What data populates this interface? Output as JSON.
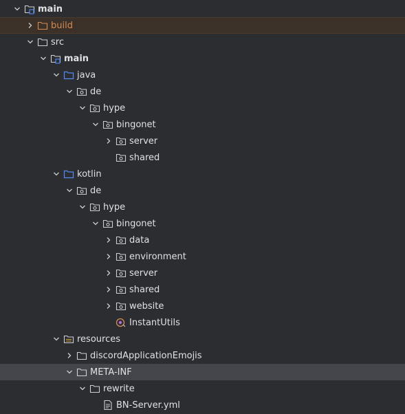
{
  "tree": [
    {
      "id": "r0",
      "label": "main",
      "depth": 0,
      "expanded": true,
      "icon": "module-folder-icon",
      "bold": true
    },
    {
      "id": "r1",
      "label": "build",
      "depth": 1,
      "expanded": false,
      "icon": "excluded-folder-icon",
      "color": "#d68b53",
      "state": "highlighted"
    },
    {
      "id": "r2",
      "label": "src",
      "depth": 1,
      "expanded": true,
      "icon": "folder-icon"
    },
    {
      "id": "r3",
      "label": "main",
      "depth": 2,
      "expanded": true,
      "icon": "module-folder-icon",
      "bold": true
    },
    {
      "id": "r4",
      "label": "java",
      "depth": 3,
      "expanded": true,
      "icon": "source-root-folder-icon"
    },
    {
      "id": "r5",
      "label": "de",
      "depth": 4,
      "expanded": true,
      "icon": "package-icon"
    },
    {
      "id": "r6",
      "label": "hype",
      "depth": 5,
      "expanded": true,
      "icon": "package-icon"
    },
    {
      "id": "r7",
      "label": "bingonet",
      "depth": 6,
      "expanded": true,
      "icon": "package-icon"
    },
    {
      "id": "r8",
      "label": "server",
      "depth": 7,
      "expanded": false,
      "icon": "package-icon"
    },
    {
      "id": "r9",
      "label": "shared",
      "depth": 7,
      "expanded": null,
      "icon": "package-icon"
    },
    {
      "id": "r10",
      "label": "kotlin",
      "depth": 3,
      "expanded": true,
      "icon": "source-root-folder-icon"
    },
    {
      "id": "r11",
      "label": "de",
      "depth": 4,
      "expanded": true,
      "icon": "package-icon"
    },
    {
      "id": "r12",
      "label": "hype",
      "depth": 5,
      "expanded": true,
      "icon": "package-icon"
    },
    {
      "id": "r13",
      "label": "bingonet",
      "depth": 6,
      "expanded": true,
      "icon": "package-icon"
    },
    {
      "id": "r14",
      "label": "data",
      "depth": 7,
      "expanded": false,
      "icon": "package-icon"
    },
    {
      "id": "r15",
      "label": "environment",
      "depth": 7,
      "expanded": false,
      "icon": "package-icon"
    },
    {
      "id": "r16",
      "label": "server",
      "depth": 7,
      "expanded": false,
      "icon": "package-icon"
    },
    {
      "id": "r17",
      "label": "shared",
      "depth": 7,
      "expanded": false,
      "icon": "package-icon"
    },
    {
      "id": "r18",
      "label": "website",
      "depth": 7,
      "expanded": false,
      "icon": "package-icon"
    },
    {
      "id": "r19",
      "label": "InstantUtils",
      "depth": 7,
      "expanded": null,
      "icon": "kotlin-object-icon"
    },
    {
      "id": "r20",
      "label": "resources",
      "depth": 3,
      "expanded": true,
      "icon": "resources-folder-icon"
    },
    {
      "id": "r21",
      "label": "discordApplicationEmojis",
      "depth": 4,
      "expanded": false,
      "icon": "folder-icon"
    },
    {
      "id": "r22",
      "label": "META-INF",
      "depth": 4,
      "expanded": true,
      "icon": "folder-icon",
      "state": "selected"
    },
    {
      "id": "r23",
      "label": "rewrite",
      "depth": 5,
      "expanded": true,
      "icon": "folder-icon"
    },
    {
      "id": "r24",
      "label": "BN-Server.yml",
      "depth": 6,
      "expanded": null,
      "icon": "yaml-file-icon"
    }
  ],
  "colors": {
    "background": "#2b2d30",
    "text": "#dfe1e5",
    "excluded": "#d68b53",
    "selected_row": "#43454a",
    "highlight_row": "#3b3129",
    "source_root_blue": "#548af7"
  }
}
